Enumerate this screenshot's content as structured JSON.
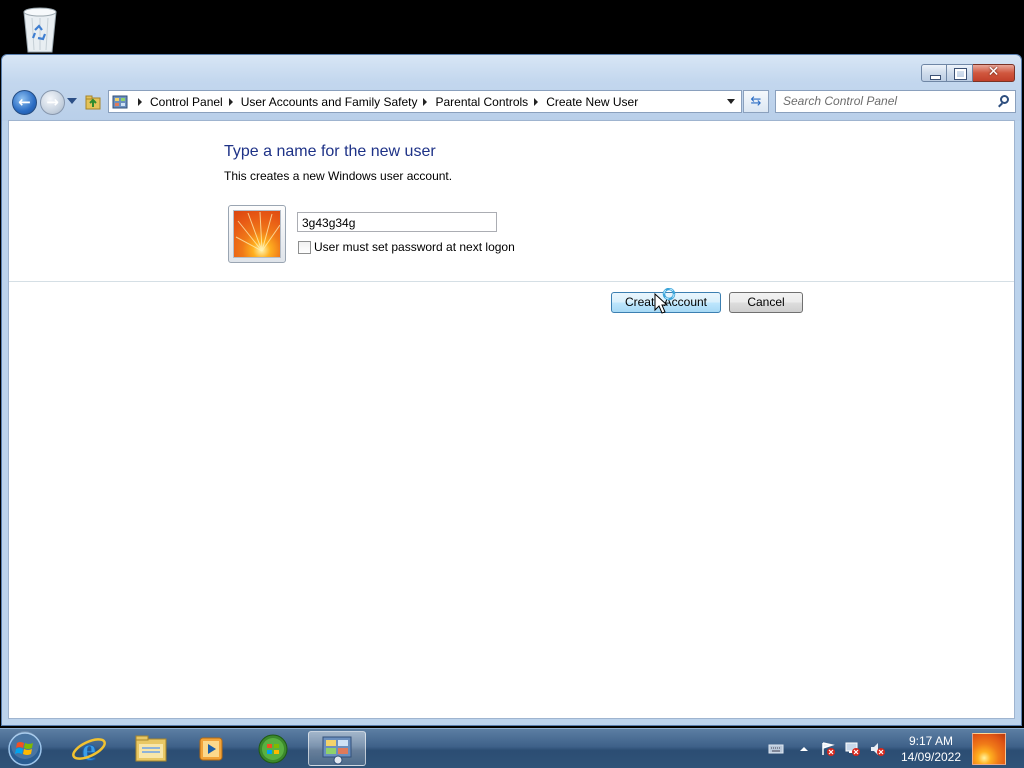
{
  "window": {
    "breadcrumbs": [
      "Control Panel",
      "User Accounts and Family Safety",
      "Parental Controls",
      "Create New User"
    ],
    "search": {
      "placeholder": "Search Control Panel"
    }
  },
  "content": {
    "heading": "Type a name for the new user",
    "subtext": "This creates a new Windows user account.",
    "name_input": {
      "value": "3g43g34g"
    },
    "checkbox": {
      "label": "User must set password at next logon",
      "checked": false
    },
    "create_button": "Create Account",
    "cancel_button": "Cancel"
  },
  "taskbar": {
    "pinned": [
      "internet-explorer-icon",
      "windows-explorer-icon",
      "media-player-icon",
      "windows-update-icon",
      "control-panel-icon"
    ],
    "clock": {
      "time": "9:17 AM",
      "date": "14/09/2022"
    }
  },
  "colors": {
    "heading": "#1e3287",
    "primary_button_border": "#3c7fb1",
    "taskbar": "#3e6189"
  }
}
